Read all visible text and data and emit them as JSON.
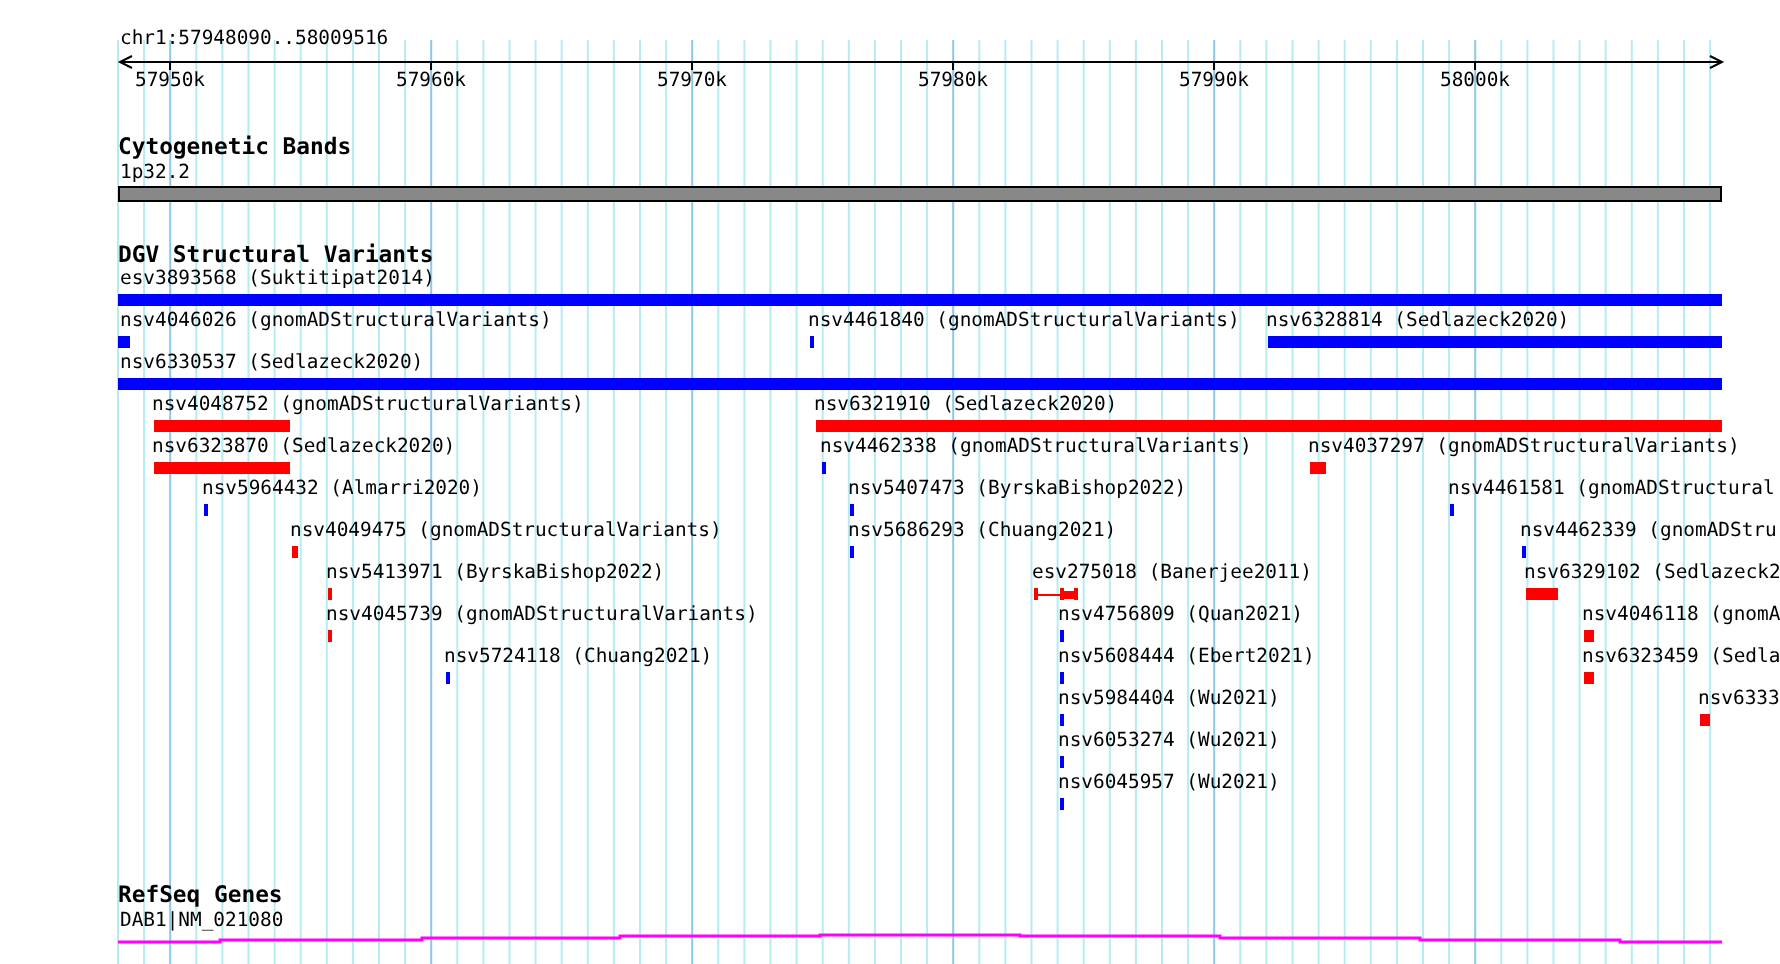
{
  "ruler": {
    "location": "chr1:57948090..58009516",
    "ticks": [
      "57950k",
      "57960k",
      "57970k",
      "57980k",
      "57990k",
      "58000k"
    ]
  },
  "cytoband_track": {
    "title": "Cytogenetic Bands",
    "band_label": "1p32.2"
  },
  "dgv_track": {
    "title": "DGV Structural Variants",
    "variants": [
      {
        "label": "esv3893568 (Suktitipat2014)",
        "color": "#0000ff",
        "kind": "bar"
      },
      {
        "label": "nsv4046026 (gnomADStructuralVariants)",
        "color": "#0000ff",
        "kind": "bar"
      },
      {
        "label": "nsv4461840 (gnomADStructuralVariants)",
        "color": "#0000ff",
        "kind": "bar"
      },
      {
        "label": "nsv6328814 (Sedlazeck2020)",
        "color": "#0000ff",
        "kind": "bar"
      },
      {
        "label": "nsv6330537 (Sedlazeck2020)",
        "color": "#0000ff",
        "kind": "bar"
      },
      {
        "label": "nsv4048752 (gnomADStructuralVariants)",
        "color": "#ff0000",
        "kind": "bar"
      },
      {
        "label": "nsv6321910 (Sedlazeck2020)",
        "color": "#ff0000",
        "kind": "bar"
      },
      {
        "label": "nsv6323870 (Sedlazeck2020)",
        "color": "#ff0000",
        "kind": "bar"
      },
      {
        "label": "nsv4462338 (gnomADStructuralVariants)",
        "color": "#0000ff",
        "kind": "bar"
      },
      {
        "label": "nsv4037297 (gnomADStructuralVariants)",
        "color": "#ff0000",
        "kind": "bar"
      },
      {
        "label": "nsv5964432 (Almarri2020)",
        "color": "#0000ff",
        "kind": "bar"
      },
      {
        "label": "nsv5407473 (ByrskaBishop2022)",
        "color": "#0000ff",
        "kind": "bar"
      },
      {
        "label": "nsv4461581 (gnomADStructural",
        "color": "#0000ff",
        "kind": "bar"
      },
      {
        "label": "nsv4049475 (gnomADStructuralVariants)",
        "color": "#ff0000",
        "kind": "bar"
      },
      {
        "label": "nsv5686293 (Chuang2021)",
        "color": "#0000ff",
        "kind": "bar"
      },
      {
        "label": "nsv4462339 (gnomADStru",
        "color": "#0000ff",
        "kind": "bar"
      },
      {
        "label": "nsv5413971 (ByrskaBishop2022)",
        "color": "#ff0000",
        "kind": "bar"
      },
      {
        "label": "esv275018 (Banerjee2011)",
        "color": "#ff0000",
        "kind": "interval"
      },
      {
        "label": "nsv6329102 (Sedlazeck2",
        "color": "#ff0000",
        "kind": "bar"
      },
      {
        "label": "nsv4045739 (gnomADStructuralVariants)",
        "color": "#ff0000",
        "kind": "bar"
      },
      {
        "label": "nsv4756809 (Quan2021)",
        "color": "#0000ff",
        "kind": "bar"
      },
      {
        "label": "nsv4046118 (gnomA",
        "color": "#ff0000",
        "kind": "bar"
      },
      {
        "label": "nsv5724118 (Chuang2021)",
        "color": "#0000ff",
        "kind": "bar"
      },
      {
        "label": "nsv5608444 (Ebert2021)",
        "color": "#0000ff",
        "kind": "bar"
      },
      {
        "label": "nsv6323459 (Sedla",
        "color": "#ff0000",
        "kind": "bar"
      },
      {
        "label": "nsv5984404 (Wu2021)",
        "color": "#0000ff",
        "kind": "bar"
      },
      {
        "label": "nsv6333",
        "color": "#ff0000",
        "kind": "bar"
      },
      {
        "label": "nsv6053274 (Wu2021)",
        "color": "#0000ff",
        "kind": "bar"
      },
      {
        "label": "nsv6045957 (Wu2021)",
        "color": "#0000ff",
        "kind": "bar"
      }
    ]
  },
  "refseq_track": {
    "title": "RefSeq Genes",
    "gene_label": "DAB1|NM_021080"
  }
}
